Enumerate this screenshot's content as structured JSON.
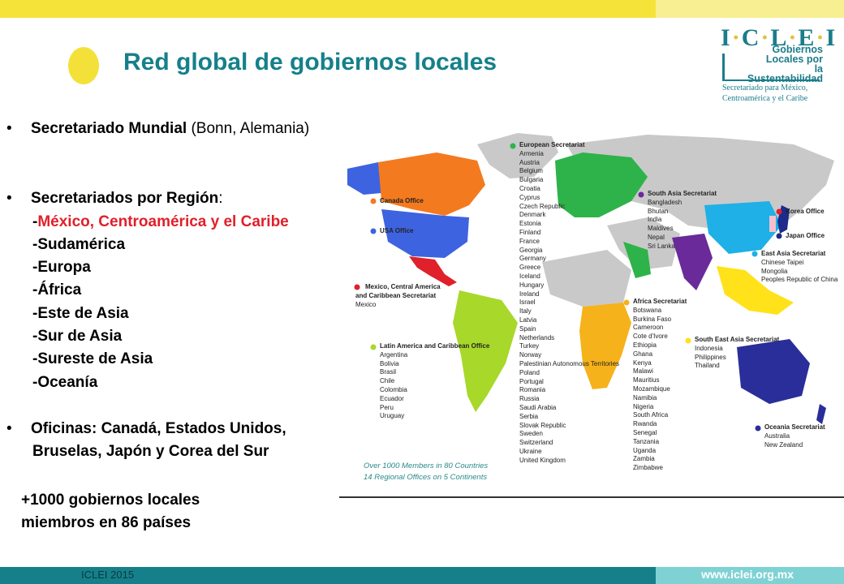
{
  "header": {
    "title": "Red global de gobiernos locales",
    "logo": {
      "letters": [
        "I",
        "C",
        "L",
        "E",
        "I"
      ],
      "tagline": [
        "Gobiernos",
        "Locales por",
        "la Sustentabilidad"
      ],
      "secretariat": [
        "Secretariado para México,",
        "Centroamérica y el Caribe"
      ]
    }
  },
  "body": {
    "world_sec_bold": "Secretariado Mundial",
    "world_sec_rest": " (Bonn, Alemania)",
    "regions_bold": "Secretariados por Región",
    "regions_colon": ":",
    "region_first_dash": "-",
    "region_first": "México, Centroamérica y el Caribe",
    "regions": [
      "-Sudamérica",
      "-Europa",
      "-África",
      "-Este de Asia",
      "-Sur de Asia",
      "-Sureste de Asia",
      "-Oceanía"
    ],
    "offices_line1": "Oficinas: Canadá, Estados Unidos,",
    "offices_line2": "Bruselas, Japón y Corea del Sur",
    "members_line1": "+1000 gobiernos locales",
    "members_line2": "miembros en 86 países"
  },
  "map": {
    "european_title": "European Secretariat",
    "european_members": [
      "Armenia",
      "Austria",
      "Belgium",
      "Bulgaria",
      "Croatia",
      "Cyprus",
      "Czech Republic",
      "Denmark",
      "Estonia",
      "Finland",
      "France",
      "Georgia",
      "Germany",
      "Greece",
      "Iceland",
      "Hungary",
      "Ireland",
      "Israel",
      "Italy",
      "Latvia",
      "Spain",
      "Netherlands",
      "Turkey",
      "Norway",
      "Palestinian Autonomous Territories",
      "Poland",
      "Portugal",
      "Romania",
      "Russia",
      "Saudi Arabia",
      "Serbia",
      "Slovak Republic",
      "Sweden",
      "Switzerland",
      "Ukraine",
      "United Kingdom"
    ],
    "south_asia_title": "South Asia Secretariat",
    "south_asia_members": [
      "Bangladesh",
      "Bhutan",
      "India",
      "Maldives",
      "Nepal",
      "Sri Lanka"
    ],
    "korea_office": "Korea Office",
    "japan_office": "Japan Office",
    "east_asia_title": "East Asia Secretariat",
    "east_asia_members": [
      "Chinese Taipei",
      "Mongolia",
      "Peoples Republic of China"
    ],
    "canada_office": "Canada Office",
    "usa_office": "USA Office",
    "mexico_title_1": "Mexico,  Central  America",
    "mexico_title_2": "and Caribbean Secretariat",
    "mexico_members": [
      "Mexico"
    ],
    "africa_title": "Africa Secretariat",
    "africa_members": [
      "Botswana",
      "Burkina Faso",
      "Cameroon",
      "Cote d'Ivore",
      "Ethiopia",
      "Ghana",
      "Kenya",
      "Malawi",
      "Mauritius",
      "Mozambique",
      "Namibia",
      "Nigeria",
      "South Africa",
      "Rwanda",
      "Senegal",
      "Tanzania",
      "Uganda",
      "Zambia",
      "Zimbabwe"
    ],
    "sea_title": "South East Asia Secretariat",
    "sea_members": [
      "Indonesia",
      "Philippines",
      "Thailand"
    ],
    "latam_title": "Latin America and Caribbean Office",
    "latam_members": [
      "Argentina",
      "Bolivia",
      "Brasil",
      "Chile",
      "Colombia",
      "Ecuador",
      "Peru",
      "Uruguay"
    ],
    "oceania_title": "Oceania Secretariat",
    "oceania_members": [
      "Australia",
      "New Zealand"
    ],
    "tagline_1": "Over 1000 Members in 80 Countries",
    "tagline_2": "14 Regional Offices on 5 Continents",
    "colors": {
      "europe": "#2db34a",
      "south_asia": "#6a2a9a",
      "east_asia": "#1eb0e6",
      "japan": "#1f2a8a",
      "canada": "#f47a1f",
      "usa": "#3e63e0",
      "mexico": "#e0202a",
      "africa": "#f5b21a",
      "sea": "#ffe21a",
      "latam": "#a8d82a",
      "oceania": "#2a2e9a",
      "land": "#c9c9c9"
    }
  },
  "footer": {
    "left": "ICLEI 2015",
    "url": "www.iclei.org.mx"
  }
}
